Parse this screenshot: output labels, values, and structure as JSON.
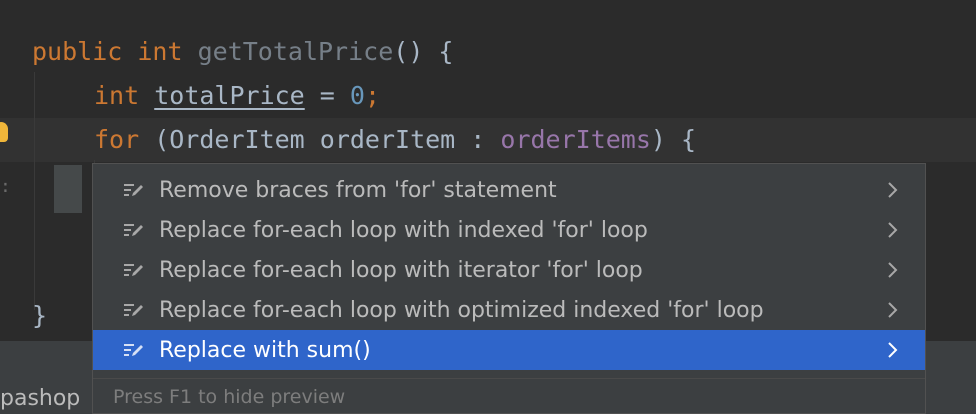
{
  "code": {
    "line1": {
      "kw1": "public",
      "kw2": "int",
      "method": "getTotalPrice",
      "rest": "() {"
    },
    "line2": {
      "kw": "int",
      "var": "totalPrice",
      "op": " = ",
      "num": "0",
      "semi": ";"
    },
    "line3": {
      "kw": "for",
      "open": " (OrderItem orderItem : ",
      "field": "orderItems",
      "close": ") {"
    },
    "closing_brace": "}"
  },
  "intention_menu": {
    "items": [
      {
        "label": "Remove braces from 'for' statement",
        "icon": "pencil-bulb-icon",
        "selected": false
      },
      {
        "label": "Replace for-each loop with indexed 'for' loop",
        "icon": "pencil-bulb-icon",
        "selected": false
      },
      {
        "label": "Replace for-each loop with iterator 'for' loop",
        "icon": "pencil-bulb-icon",
        "selected": false
      },
      {
        "label": "Replace for-each loop with optimized indexed 'for' loop",
        "icon": "pencil-bulb-icon",
        "selected": false
      },
      {
        "label": "Replace with sum()",
        "icon": "pencil-bulb-icon",
        "selected": true
      }
    ],
    "footer": "Press F1 to hide preview"
  },
  "project": {
    "label": "pashop"
  },
  "colors": {
    "editor_bg": "#2b2b2b",
    "keyword": "#cc7832",
    "number": "#6897bb",
    "field": "#9876aa",
    "selection": "#2f65ca",
    "popup_bg": "#3c3f41"
  }
}
